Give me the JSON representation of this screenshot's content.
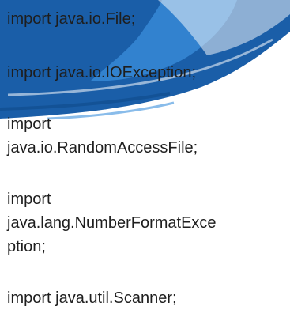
{
  "document": {
    "lines": [
      "import java.io.File;",
      "import java.io.IOException;",
      "import",
      "java.io.RandomAccessFile;",
      "import",
      "java.lang.NumberFormatExce",
      "ption;",
      "import java.util.Scanner;"
    ]
  },
  "colors": {
    "brush_dark": "#1a5ea8",
    "brush_light": "#3b8fdc",
    "text": "#1e1e1e"
  }
}
